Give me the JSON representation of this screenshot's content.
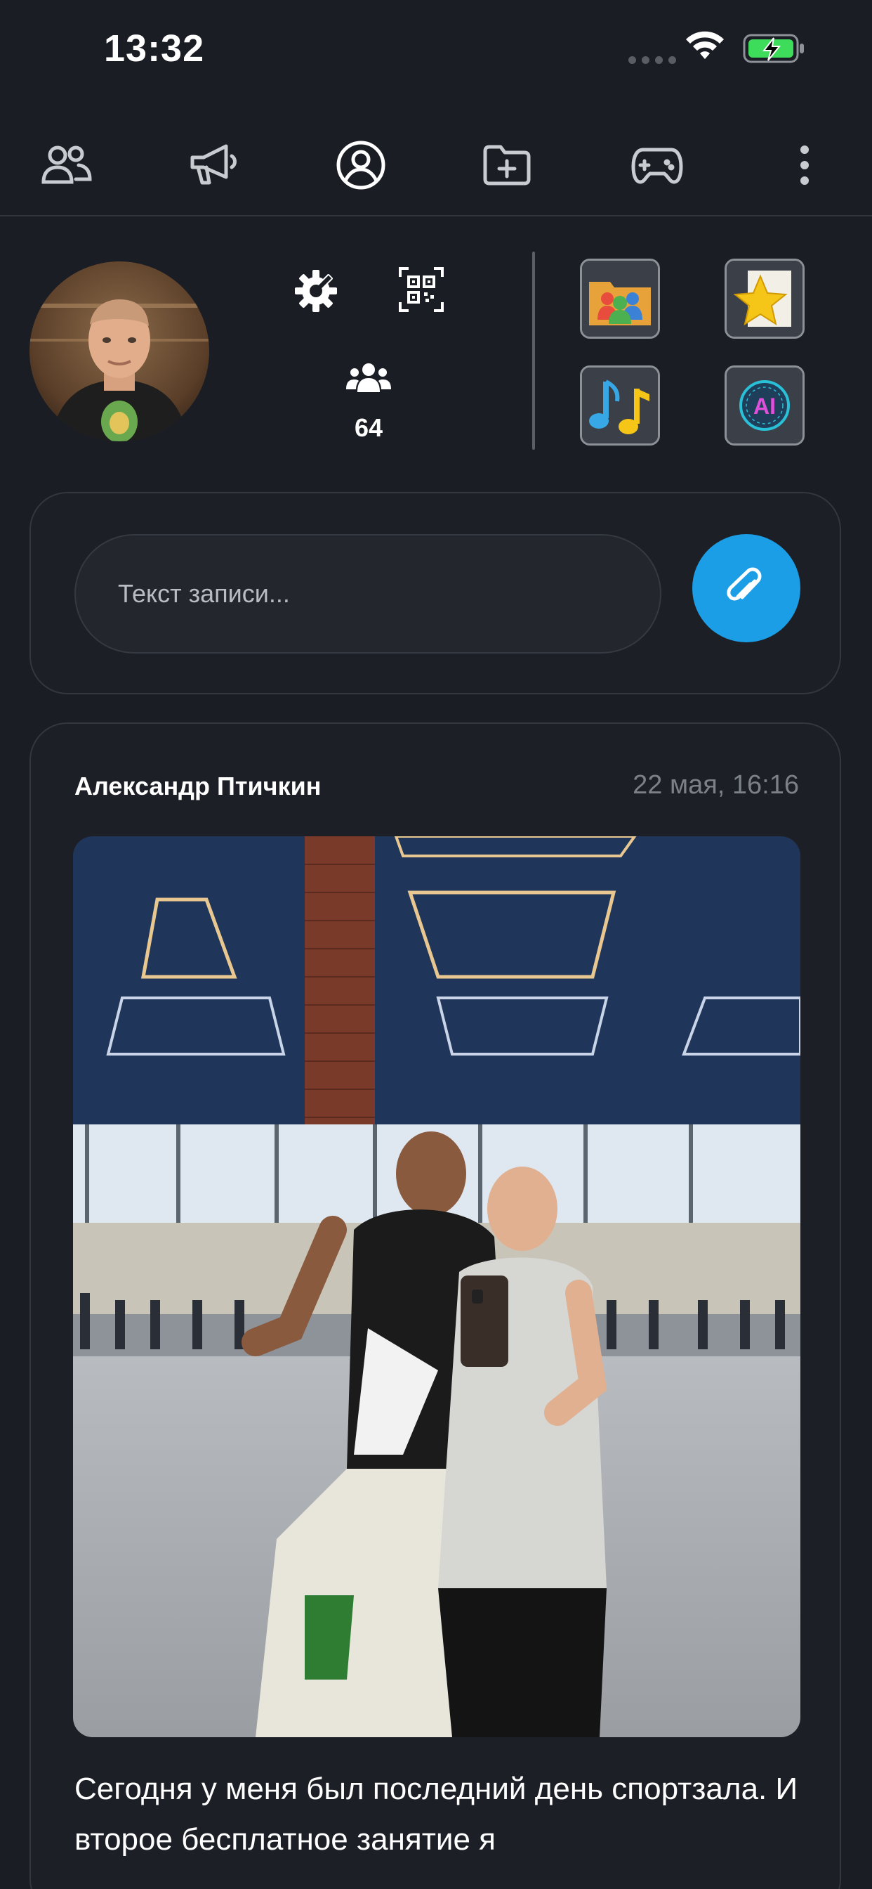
{
  "status_bar": {
    "time": "13:32"
  },
  "tabs": [
    {
      "icon": "friends-icon"
    },
    {
      "icon": "megaphone-icon"
    },
    {
      "icon": "profile-icon",
      "active": true
    },
    {
      "icon": "folder-add-icon"
    },
    {
      "icon": "gamepad-icon"
    },
    {
      "icon": "more-vertical-icon"
    }
  ],
  "profile": {
    "friends_count": "64"
  },
  "apps": [
    {
      "icon": "contacts-folder-icon"
    },
    {
      "icon": "favorites-star-icon"
    },
    {
      "icon": "music-icon"
    },
    {
      "icon": "ai-icon",
      "label": "AI"
    }
  ],
  "composer": {
    "placeholder": "Текст записи..."
  },
  "post": {
    "author": "Александр Птичкин",
    "date": "22 мая, 16:16",
    "text": "Сегодня у меня был последний день спортзала. И второе бесплатное занятие я"
  },
  "colors": {
    "background": "#1a1d23",
    "card": "#1c1f25",
    "accent": "#1b9ee6",
    "muted_text": "#7c8088"
  }
}
